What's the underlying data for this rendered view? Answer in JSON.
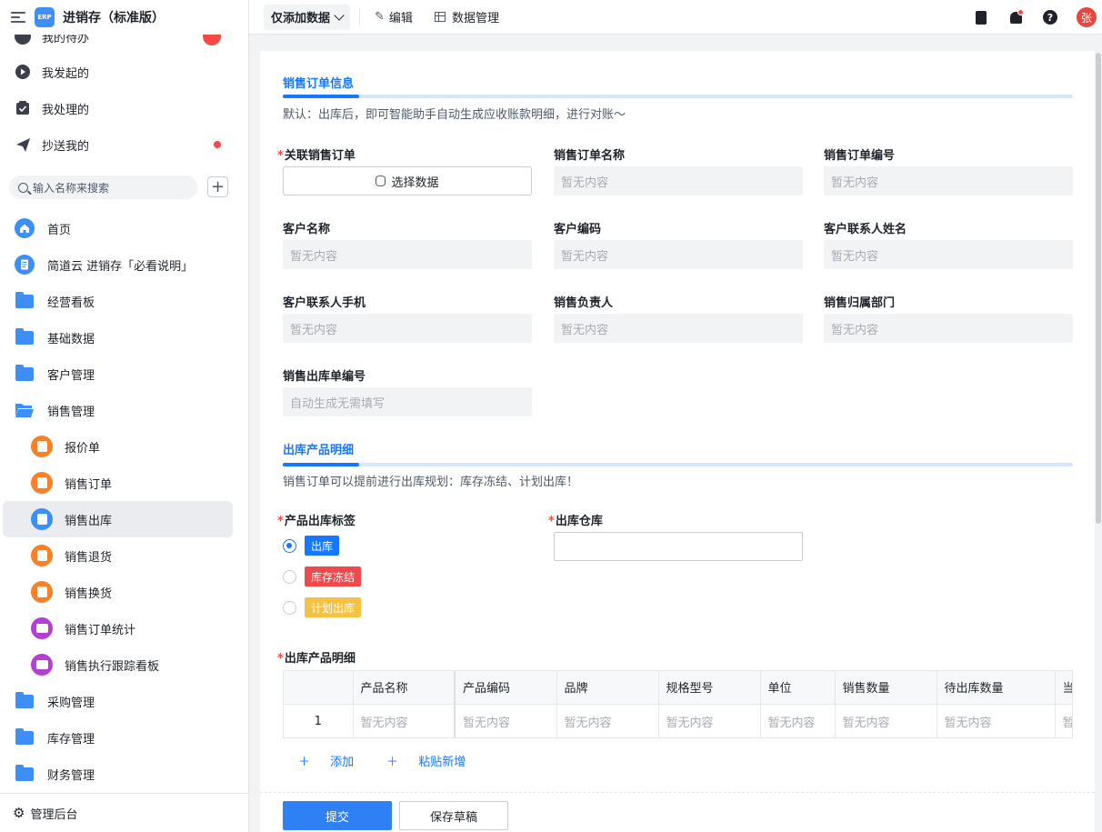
{
  "app": {
    "logo_text": "ERP",
    "title": "进销存（标准版）"
  },
  "sidebar": {
    "flow_items": [
      {
        "label": "我的待办",
        "icon": "todo-icon"
      },
      {
        "label": "我发起的",
        "icon": "play-circle-icon"
      },
      {
        "label": "我处理的",
        "icon": "check-box-icon"
      },
      {
        "label": "抄送我的",
        "icon": "send-icon"
      }
    ],
    "search_placeholder": "输入名称来搜索",
    "add_label": "+",
    "menu": [
      {
        "label": "首页",
        "icon": "home-icon"
      },
      {
        "label": "简道云 进销存「必看说明」",
        "icon": "document-icon"
      },
      {
        "label": "经营看板",
        "icon": "folder-icon"
      },
      {
        "label": "基础数据",
        "icon": "folder-icon"
      },
      {
        "label": "客户管理",
        "icon": "folder-icon"
      },
      {
        "label": "销售管理",
        "icon": "folder-open-icon"
      },
      {
        "label": "报价单",
        "icon": "form-icon"
      },
      {
        "label": "销售订单",
        "icon": "form-icon"
      },
      {
        "label": "销售出库",
        "icon": "form-icon"
      },
      {
        "label": "销售退货",
        "icon": "form-icon"
      },
      {
        "label": "销售换货",
        "icon": "form-icon"
      },
      {
        "label": "销售订单统计",
        "icon": "report-icon"
      },
      {
        "label": "销售执行跟踪看板",
        "icon": "report-icon"
      },
      {
        "label": "采购管理",
        "icon": "folder-icon"
      },
      {
        "label": "库存管理",
        "icon": "folder-icon"
      },
      {
        "label": "财务管理",
        "icon": "folder-icon"
      }
    ],
    "footer": "管理后台"
  },
  "topbar": {
    "mode": "仅添加数据",
    "edit": "编辑",
    "data_manage": "数据管理",
    "avatar": "张"
  },
  "form": {
    "section1": {
      "title": "销售订单信息",
      "desc": "默认：出库后，即可智能助手自动生成应收账款明细，进行对账～"
    },
    "fields": {
      "related_order": {
        "label": "关联销售订单",
        "button": "选择数据"
      },
      "order_name": {
        "label": "销售订单名称",
        "value": "暂无内容"
      },
      "order_no": {
        "label": "销售订单编号",
        "value": "暂无内容"
      },
      "customer_name": {
        "label": "客户名称",
        "value": "暂无内容"
      },
      "customer_code": {
        "label": "客户编码",
        "value": "暂无内容"
      },
      "contact_name": {
        "label": "客户联系人姓名",
        "value": "暂无内容"
      },
      "contact_phone": {
        "label": "客户联系人手机",
        "value": "暂无内容"
      },
      "sales_owner": {
        "label": "销售负责人",
        "value": "暂无内容"
      },
      "sales_dept": {
        "label": "销售归属部门",
        "value": "暂无内容"
      },
      "outbound_no": {
        "label": "销售出库单编号",
        "value": "自动生成无需填写"
      }
    },
    "section2": {
      "title": "出库产品明细",
      "desc": "销售订单可以提前进行出库规划：库存冻结、计划出库！"
    },
    "outbound_tag": {
      "label": "产品出库标签",
      "options": [
        {
          "label": "出库",
          "color": "#1677ff",
          "checked": true
        },
        {
          "label": "库存冻结",
          "color": "#f0494c",
          "checked": false
        },
        {
          "label": "计划出库",
          "color": "#f5c242",
          "checked": false
        }
      ]
    },
    "warehouse": {
      "label": "出库仓库",
      "value": ""
    },
    "detail_table": {
      "label": "出库产品明细",
      "columns": [
        "",
        "产品名称",
        "产品编码",
        "品牌",
        "规格型号",
        "单位",
        "销售数量",
        "待出库数量",
        "当"
      ],
      "rows": [
        [
          "1",
          "暂无内容",
          "暂无内容",
          "暂无内容",
          "暂无内容",
          "暂无内容",
          "暂无内容",
          "暂无内容",
          "暂"
        ]
      ],
      "add": "添加",
      "paste": "粘贴新增"
    },
    "buttons": {
      "submit": "提交",
      "draft": "保存草稿"
    }
  }
}
